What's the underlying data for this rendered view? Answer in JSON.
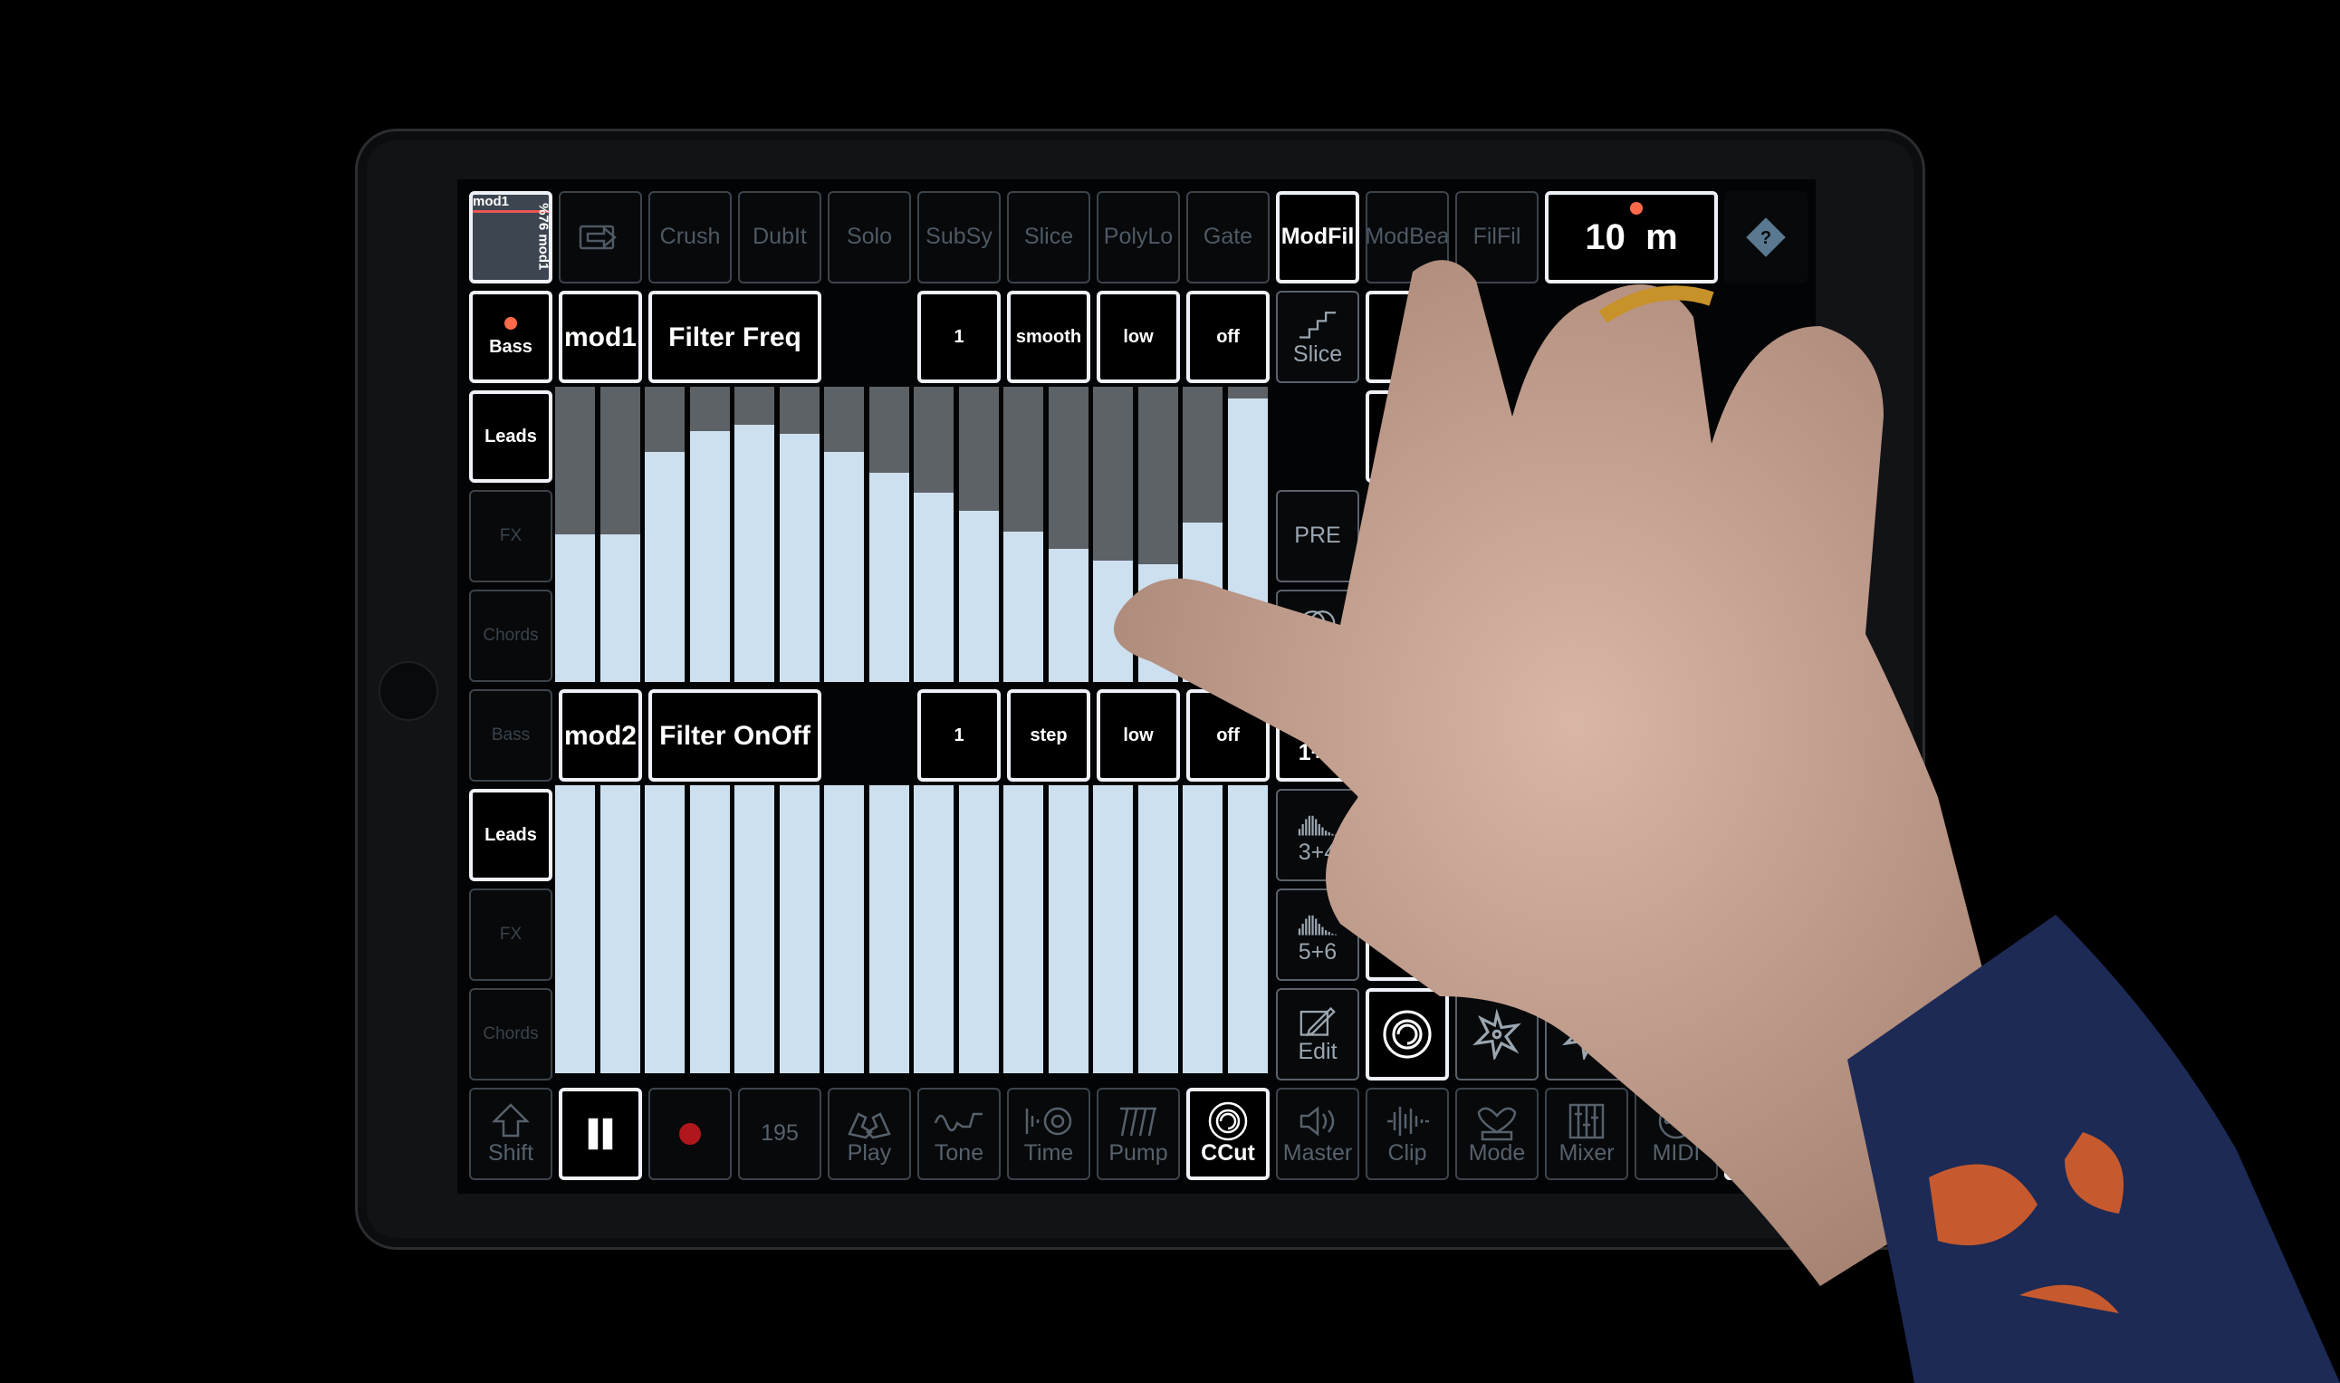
{
  "colors": {
    "active_border": "#eef1f8",
    "inactive_border": "#3c444c",
    "bar_fill": "#cde0f0",
    "bar_track": "#5d6266",
    "record": "#b0171c",
    "indicator": "#ff6a4a"
  },
  "top_row": {
    "thumb": {
      "label": "mod1",
      "value": "%76",
      "sub": "mod1"
    },
    "items": [
      {
        "icon": "arrow-right-icon"
      },
      {
        "label": "Crush"
      },
      {
        "label": "DubIt"
      },
      {
        "label": "Solo"
      },
      {
        "label": "SubSy"
      },
      {
        "label": "Slice"
      },
      {
        "label": "PolyLo"
      },
      {
        "label": "Gate"
      },
      {
        "label": "ModFil",
        "active": true
      },
      {
        "label": "ModBea"
      },
      {
        "label": "FilFil"
      }
    ],
    "tempo_display": {
      "value": "10",
      "unit": "m"
    },
    "help_icon": "help-diamond-icon"
  },
  "tracks": [
    {
      "label": "Bass",
      "active": true,
      "indicator": true
    },
    {
      "label": "Leads",
      "active": true
    },
    {
      "label": "FX"
    },
    {
      "label": "Chords"
    },
    {
      "label": "Bass"
    },
    {
      "label": "Leads",
      "active": true
    },
    {
      "label": "FX"
    },
    {
      "label": "Chords"
    }
  ],
  "lanes": [
    {
      "mod": "mod1",
      "target": "Filter Freq",
      "rate": "1",
      "mode": "smooth",
      "range": "low",
      "sync": "off",
      "values": [
        0.5,
        0.5,
        0.78,
        0.85,
        0.87,
        0.84,
        0.78,
        0.71,
        0.64,
        0.58,
        0.51,
        0.45,
        0.41,
        0.4,
        0.54,
        0.96
      ]
    },
    {
      "mod": "mod2",
      "target": "Filter OnOff",
      "rate": "1",
      "mode": "step",
      "range": "low",
      "sync": "off",
      "values": [
        1,
        1,
        1,
        1,
        1,
        1,
        1,
        1,
        1,
        1,
        1,
        1,
        1,
        1,
        1,
        1
      ]
    }
  ],
  "side_panel": [
    {
      "label": "Slice",
      "icon": "staircase-icon"
    },
    {
      "label": "PRE"
    },
    {
      "label": "C+F",
      "icon": "crossfade-icon"
    },
    {
      "label": "1+2",
      "icon": "spectrum-icon",
      "active": true
    },
    {
      "label": "3+4",
      "icon": "spectrum-icon"
    },
    {
      "label": "5+6",
      "icon": "spectrum-icon"
    },
    {
      "label": "Edit",
      "icon": "edit-icon"
    }
  ],
  "bottom_row": [
    {
      "label": "Shift",
      "icon": "shift-arrow-icon"
    },
    {
      "icon": "pause-icon",
      "active": true
    },
    {
      "icon": "record-icon"
    },
    {
      "label": "195"
    },
    {
      "label": "Play",
      "icon": "hands-icon"
    },
    {
      "label": "Tone",
      "icon": "waveform-icon"
    },
    {
      "label": "Time",
      "icon": "time-icon"
    },
    {
      "label": "Pump",
      "icon": "pump-icon"
    },
    {
      "label": "CCut",
      "icon": "ccut-icon",
      "active": true
    },
    {
      "label": "Master",
      "icon": "speaker-icon"
    },
    {
      "label": "Clip",
      "icon": "clip-wave-icon"
    },
    {
      "label": "Mode",
      "icon": "mode-icon"
    },
    {
      "label": "Mixer",
      "icon": "mixer-icon"
    },
    {
      "label": "MIDI",
      "icon": "midi-icon"
    },
    {
      "label": ">",
      "active": true
    }
  ]
}
